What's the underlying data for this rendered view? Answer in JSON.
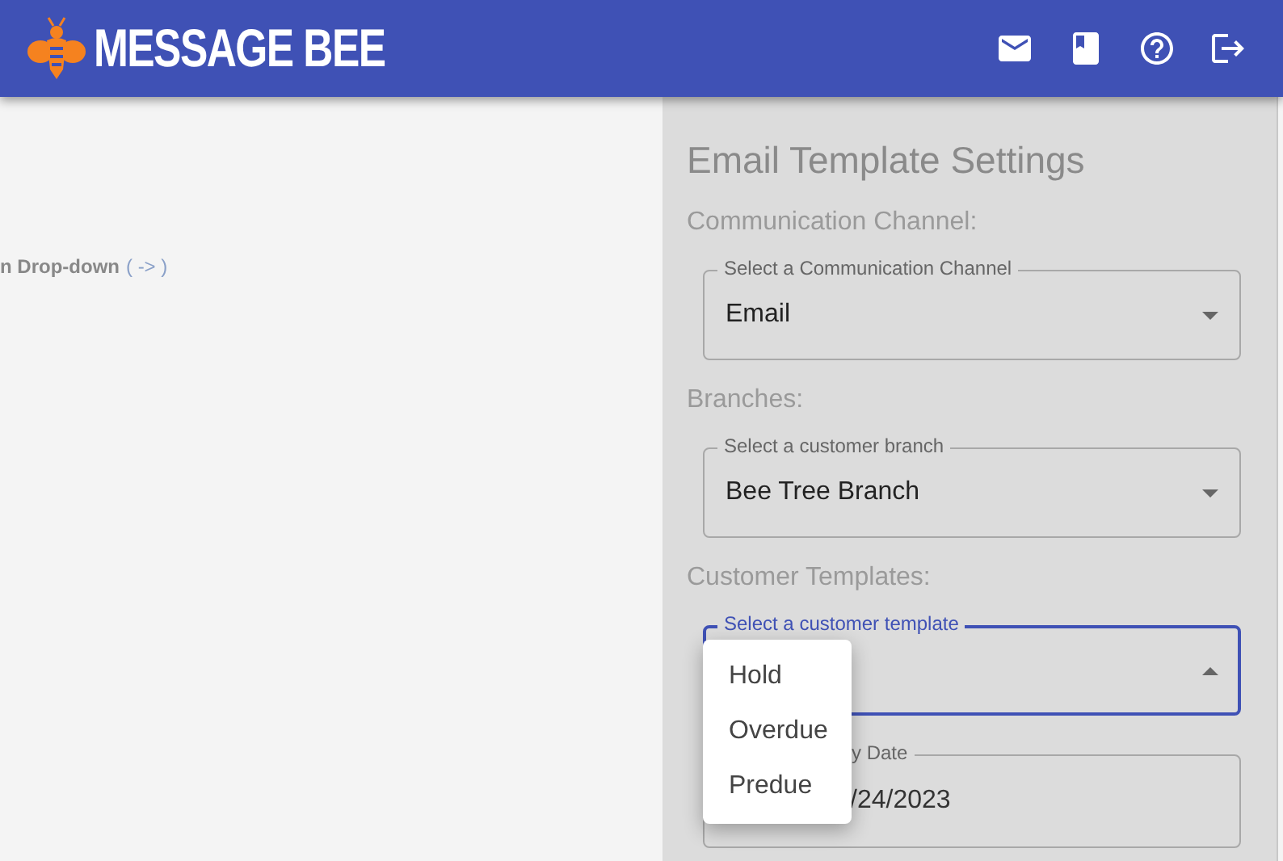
{
  "header": {
    "brand": "MESSAGE BEE"
  },
  "left_panel": {
    "hint_text": "n Drop-down",
    "hint_link": "( -> )"
  },
  "settings": {
    "title": "Email Template Settings",
    "sections": [
      {
        "heading": "Communication Channel:",
        "field": {
          "label": "Select a Communication Channel",
          "value": "Email",
          "expanded": false
        }
      },
      {
        "heading": "Branches:",
        "field": {
          "label": "Select a customer branch",
          "value": "Bee Tree Branch",
          "expanded": false
        }
      },
      {
        "heading": "Customer Templates:",
        "field": {
          "label": "Select a customer template",
          "expanded": true
        }
      }
    ],
    "date_field": {
      "label": "y Date",
      "value": "/24/2023"
    }
  },
  "menu": {
    "items": [
      {
        "label": "Hold",
        "selected": false
      },
      {
        "label": "Overdue",
        "selected": false
      },
      {
        "label": "Predue",
        "selected": false
      }
    ]
  }
}
